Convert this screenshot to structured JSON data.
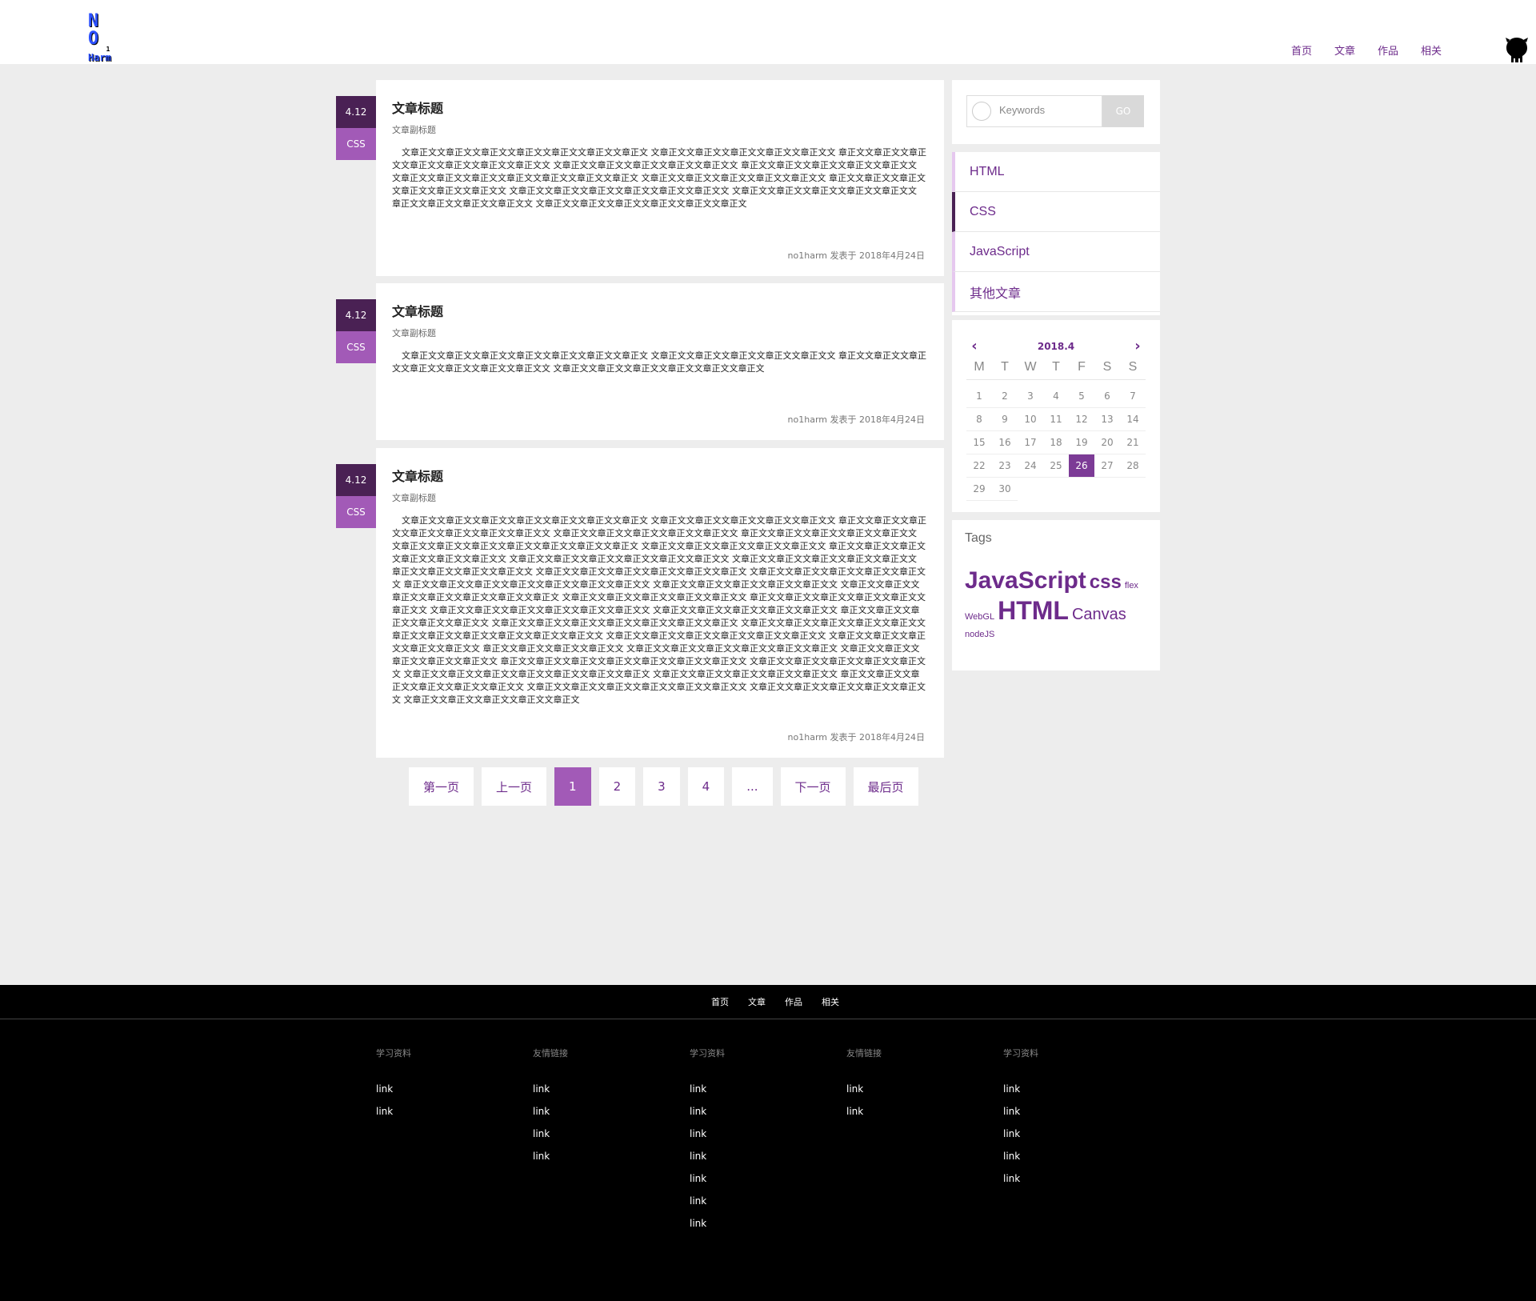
{
  "header": {
    "logo": {
      "line1": "N O",
      "line2": "1",
      "line3": "Harm"
    },
    "nav": [
      "首页",
      "文章",
      "作品",
      "相关"
    ]
  },
  "articles": [
    {
      "date": "4.12",
      "tag": "CSS",
      "title": "文章标题",
      "subtitle": "文章副标题",
      "body": "文章正文文章正文文章正文文章正文文章正文文章正文文章正文 文章正文文章正文文章正文文章正文文章正文文 章正文文章正文文章正文文章正文文章正文文章正文文章正文文 文章正文文章正文文章正文文章正文文章正文文 章正文文章正文文章正文文章正文文章正文文 文章正文文章正文文章正文文章正文文章正文文章正文文章正文 文章正文文章正文文章正文文章正文文章正文文 章正文文章正文文章正文文章正文文章正文文章正文文 文章正文文章正文文章正文文章正文文章正文文章正文文 文章正文文章正文文章正文文章正文文章正文文 章正文文章正文文章正文文章正文文 文章正文文章正文文章正文文章正文文章正文文章正文",
      "meta": "no1harm 发表于 2018年4月24日"
    },
    {
      "date": "4.12",
      "tag": "CSS",
      "title": "文章标题",
      "subtitle": "文章副标题",
      "body": "文章正文文章正文文章正文文章正文文章正文文章正文文章正文 文章正文文章正文文章正文文章正文文章正文文 章正文文章正文文章正文文章正文文章正文文章正文文章正文文 文章正文文章正文文章正文文章正文文章正文文章正文",
      "meta": "no1harm 发表于 2018年4月24日"
    },
    {
      "date": "4.12",
      "tag": "CSS",
      "title": "文章标题",
      "subtitle": "文章副标题",
      "body": "文章正文文章正文文章正文文章正文文章正文文章正文文章正文 文章正文文章正文文章正文文章正文文章正文文 章正文文章正文文章正文文章正文文章正文文章正文文章正文文 文章正文文章正文文章正文文章正文文章正文文 章正文文章正文文章正文文章正文文章正文文 文章正文文章正文文章正文文章正文文章正文文章正文文章正文 文章正文文章正文文章正文文章正文文章正文文 章正文文章正文文章正文文章正文文章正文文章正文文 文章正文文章正文文章正文文章正文文章正文文章正文文 文章正文文章正文文章正文文章正文文章正文文 章正文文章正文文章正文文章正文文 文章正文文章正文文章正文文章正文文章正文文章正文 文章正文文章正文文章正文文章正文文章正文文 章正文文章正文文章正文文章正文文章正文文章正文文章正文文 文章正文文章正文文章正文文章正文文章正文文 文章正文文章正文文章正文文章正文文章正文文章正文文章正文 文章正文文章正文文章正文文章正文文章正文文 章正文文章正文文章正文文章正文文章正文文章正文文 文章正文文章正文文章正文文章正文文章正文文章正文文 文章正文文章正文文章正文文章正文文章正文文 章正文文章正文文章正文文章正文文章正文文 文章正文文章正文文章正文文章正文文章正文文章正文文章正文 文章正文文章正文文章正文文章正文文章正文文 章正文文章正文文章正文文章正文文章正文文章正文文 文章正文文章正文文章正文文章正文文章正文文章正文文 文章正文文章正文文章正文文章正文文章正文文 章正文文章正文文章正文文章正文文 文章正文文章正文文章正文文章正文文章正文文章正文 文章正文文章正文文章正文文章正文文章正文文 章正文文章正文文章正文文章正文文章正文文章正文文章正文文 文章正文文章正文文章正文文章正文文章正文文 文章正文文章正文文章正文文章正文文章正文文章正文文章正文 文章正文文章正文文章正文文章正文文章正文文 章正文文章正文文章正文文章正文文章正文文章正文文 文章正文文章正文文章正文文章正文文章正文文章正文文 文章正文文章正文文章正文文章正文文章正文文 文章正文文章正文文章正文文章正文文章正文",
      "meta": "no1harm 发表于 2018年4月24日"
    }
  ],
  "pagination": {
    "first": "第一页",
    "prev": "上一页",
    "pages": [
      "1",
      "2",
      "3",
      "4"
    ],
    "ellipsis": "...",
    "next": "下一页",
    "last": "最后页",
    "current": "1"
  },
  "search": {
    "placeholder": "Keywords",
    "button": "GO"
  },
  "categories": [
    "HTML",
    "CSS",
    "JavaScript",
    "其他文章"
  ],
  "selected_category": "CSS",
  "calendar": {
    "title": "2018.4",
    "weekdays": [
      "M",
      "T",
      "W",
      "T",
      "F",
      "S",
      "S"
    ],
    "weeks": [
      [
        "1",
        "2",
        "3",
        "4",
        "5",
        "6",
        "7"
      ],
      [
        "8",
        "9",
        "10",
        "11",
        "12",
        "13",
        "14"
      ],
      [
        "15",
        "16",
        "17",
        "18",
        "19",
        "20",
        "21"
      ],
      [
        "22",
        "23",
        "24",
        "25",
        "26",
        "27",
        "28"
      ],
      [
        "29",
        "30"
      ]
    ],
    "today": "26"
  },
  "tags": {
    "title": "Tags",
    "items": [
      "JavaScript",
      "css",
      "flex",
      "WebGL",
      "HTML",
      "Canvas",
      "nodeJS"
    ]
  },
  "footer": {
    "nav": [
      "首页",
      "文章",
      "作品",
      "相关"
    ],
    "columns": [
      {
        "title": "学习资料",
        "links": [
          "link",
          "link"
        ]
      },
      {
        "title": "友情链接",
        "links": [
          "link",
          "link",
          "link",
          "link"
        ]
      },
      {
        "title": "学习资料",
        "links": [
          "link",
          "link",
          "link",
          "link",
          "link",
          "link",
          "link"
        ]
      },
      {
        "title": "友情链接",
        "links": [
          "link",
          "link"
        ]
      },
      {
        "title": "学习资料",
        "links": [
          "link",
          "link",
          "link",
          "link",
          "link"
        ]
      }
    ]
  },
  "colors": {
    "accent": "#6d2b8b",
    "date_badge": "#4a2154",
    "tag_badge": "#a25ab7",
    "page_bg": "#ededed",
    "footer_bg": "#000000"
  }
}
